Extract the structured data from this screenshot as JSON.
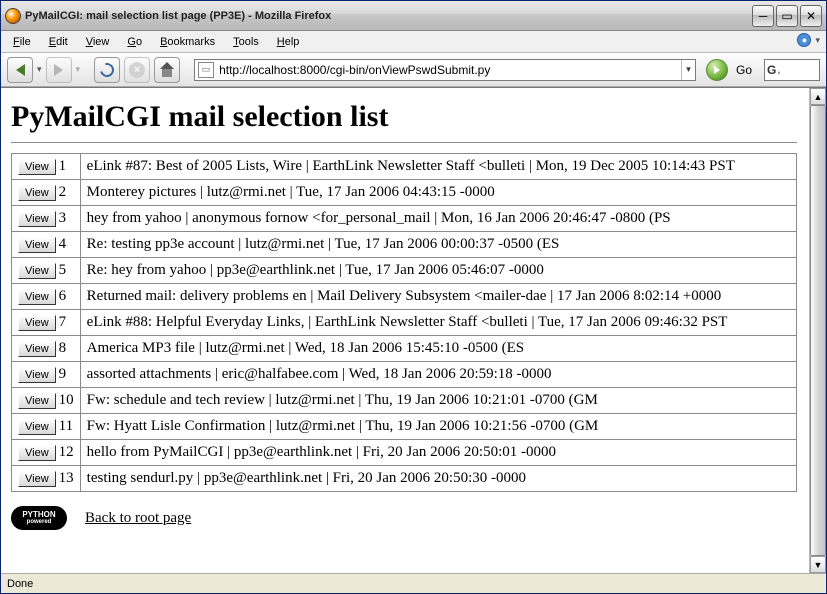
{
  "window": {
    "title": "PyMailCGI: mail selection list page (PP3E) - Mozilla Firefox",
    "status": "Done"
  },
  "menu": {
    "file": {
      "label": "File",
      "accel": "F"
    },
    "edit": {
      "label": "Edit",
      "accel": "E"
    },
    "view": {
      "label": "View",
      "accel": "V"
    },
    "go": {
      "label": "Go",
      "accel": "G"
    },
    "bookmarks": {
      "label": "Bookmarks",
      "accel": "B"
    },
    "tools": {
      "label": "Tools",
      "accel": "T"
    },
    "help": {
      "label": "Help",
      "accel": "H"
    }
  },
  "nav": {
    "url": "http://localhost:8000/cgi-bin/onViewPswdSubmit.py",
    "go_label": "Go"
  },
  "page": {
    "heading": "PyMailCGI mail selection list",
    "view_button_label": "View",
    "rows": [
      {
        "n": "1",
        "text": "eLink #87: Best of 2005 Lists, Wire | EarthLink Newsletter Staff <bulleti | Mon, 19 Dec 2005 10:14:43 PST"
      },
      {
        "n": "2",
        "text": "Monterey pictures | lutz@rmi.net | Tue, 17 Jan 2006 04:43:15 -0000"
      },
      {
        "n": "3",
        "text": "hey from yahoo | anonymous fornow <for_personal_mail | Mon, 16 Jan 2006 20:46:47 -0800 (PS"
      },
      {
        "n": "4",
        "text": "Re: testing pp3e account | lutz@rmi.net | Tue, 17 Jan 2006 00:00:37 -0500 (ES"
      },
      {
        "n": "5",
        "text": "Re: hey from yahoo | pp3e@earthlink.net | Tue, 17 Jan 2006 05:46:07 -0000"
      },
      {
        "n": "6",
        "text": "Returned mail: delivery problems en | Mail Delivery Subsystem <mailer-dae | 17 Jan 2006 8:02:14 +0000"
      },
      {
        "n": "7",
        "text": "eLink #88: Helpful Everyday Links, | EarthLink Newsletter Staff <bulleti | Tue, 17 Jan 2006 09:46:32 PST"
      },
      {
        "n": "8",
        "text": "America MP3 file | lutz@rmi.net | Wed, 18 Jan 2006 15:45:10 -0500 (ES"
      },
      {
        "n": "9",
        "text": "assorted attachments | eric@halfabee.com | Wed, 18 Jan 2006 20:59:18 -0000"
      },
      {
        "n": "10",
        "text": "Fw: schedule and tech review | lutz@rmi.net | Thu, 19 Jan 2006 10:21:01 -0700 (GM"
      },
      {
        "n": "11",
        "text": "Fw: Hyatt Lisle Confirmation | lutz@rmi.net | Thu, 19 Jan 2006 10:21:56 -0700 (GM"
      },
      {
        "n": "12",
        "text": "hello from PyMailCGI | pp3e@earthlink.net | Fri, 20 Jan 2006 20:50:01 -0000"
      },
      {
        "n": "13",
        "text": "testing sendurl.py | pp3e@earthlink.net | Fri, 20 Jan 2006 20:50:30 -0000"
      }
    ],
    "badge_line1": "PYTHON",
    "badge_line2": "powered",
    "back_link": "Back to root page"
  }
}
